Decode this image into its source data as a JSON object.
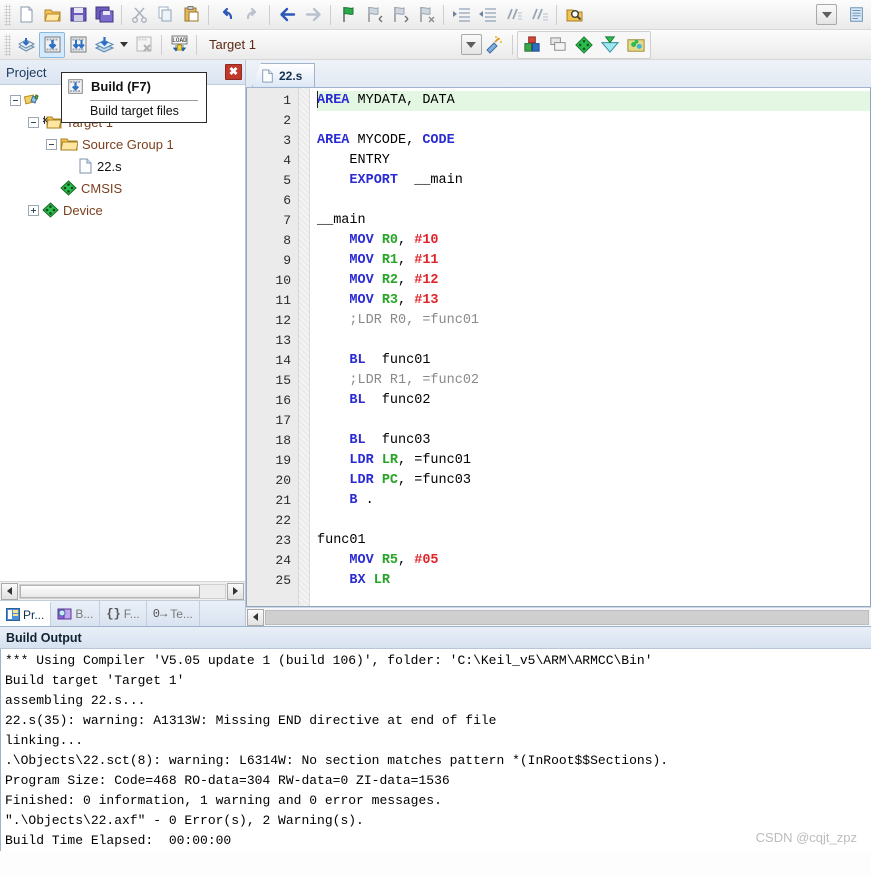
{
  "toolbar_main": {
    "buttons": [
      {
        "name": "new-file-icon",
        "title": "New"
      },
      {
        "name": "open-file-icon",
        "title": "Open"
      },
      {
        "name": "save-icon",
        "title": "Save"
      },
      {
        "name": "save-all-icon",
        "title": "Save All"
      },
      {
        "name": "cut-icon",
        "title": "Cut"
      },
      {
        "name": "copy-icon",
        "title": "Copy"
      },
      {
        "name": "paste-icon",
        "title": "Paste"
      },
      {
        "name": "undo-icon",
        "title": "Undo"
      },
      {
        "name": "redo-icon",
        "title": "Redo"
      },
      {
        "name": "navigate-back-icon",
        "title": "Back"
      },
      {
        "name": "navigate-forward-icon",
        "title": "Forward"
      },
      {
        "name": "bookmark-toggle-icon",
        "title": "Insert/Remove Bookmark"
      },
      {
        "name": "bookmark-prev-icon",
        "title": "Previous Bookmark"
      },
      {
        "name": "bookmark-next-icon",
        "title": "Next Bookmark"
      },
      {
        "name": "bookmark-clear-icon",
        "title": "Clear All Bookmarks"
      },
      {
        "name": "indent-icon",
        "title": "Indent"
      },
      {
        "name": "outdent-icon",
        "title": "Outdent"
      },
      {
        "name": "comment-icon",
        "title": "Comment"
      },
      {
        "name": "uncomment-icon",
        "title": "Uncomment"
      },
      {
        "name": "find-in-files-icon",
        "title": "Find in Files"
      }
    ]
  },
  "toolbar_build": {
    "buttons": [
      {
        "name": "translate-icon",
        "title": "Translate"
      },
      {
        "name": "build-icon",
        "title": "Build",
        "hot": true
      },
      {
        "name": "rebuild-icon",
        "title": "Rebuild"
      },
      {
        "name": "batch-build-icon",
        "title": "Batch Build"
      },
      {
        "name": "stop-build-icon",
        "title": "Stop Build"
      },
      {
        "name": "download-icon",
        "title": "Download"
      }
    ],
    "target": "Target 1",
    "target_options": [
      "Target 1"
    ],
    "right_buttons": [
      {
        "name": "target-options-icon",
        "title": "Options for Target"
      },
      {
        "name": "manage-project-items-icon",
        "title": "Manage Project Items"
      },
      {
        "name": "multi-project-icon",
        "title": "Multi-Project"
      },
      {
        "name": "pack-installer-icon",
        "title": "Pack Installer"
      },
      {
        "name": "manage-run-env-icon",
        "title": "Manage Run-Time Environment"
      },
      {
        "name": "pack-manage-icon",
        "title": "Select Software Packs"
      }
    ]
  },
  "tooltip": {
    "title": "Build (F7)",
    "description": "Build target files",
    "icon": "build-icon"
  },
  "project_panel": {
    "title": "Project",
    "close_label": "✖",
    "tree": [
      {
        "level": 0,
        "label": "",
        "icon": "project-icon",
        "expander": "minus",
        "hidden_label": true
      },
      {
        "level": 1,
        "label": "Target 1",
        "icon": "target-icon",
        "expander": "minus"
      },
      {
        "level": 2,
        "label": "Source Group 1",
        "icon": "folder-icon",
        "expander": "minus"
      },
      {
        "level": 3,
        "label": "22.s",
        "icon": "source-file-icon",
        "expander": "none"
      },
      {
        "level": 2,
        "label": "CMSIS",
        "icon": "component-icon",
        "expander": "none"
      },
      {
        "level": 2,
        "label": "Device",
        "icon": "component-icon",
        "expander": "plus"
      }
    ],
    "tabs": [
      {
        "label": "Pr...",
        "name": "tab-project",
        "icon": "project-tab-icon",
        "active": true
      },
      {
        "label": "B...",
        "name": "tab-books",
        "icon": "books-tab-icon",
        "active": false
      },
      {
        "label": "F...",
        "name": "tab-functions",
        "icon": "functions-tab-icon",
        "active": false
      },
      {
        "label": "Te...",
        "name": "tab-templates",
        "icon": "templates-tab-icon",
        "active": false
      }
    ]
  },
  "editor": {
    "tabs": [
      {
        "label": "22.s",
        "active": true,
        "icon": "source-file-icon"
      }
    ],
    "lines": [
      {
        "n": 1,
        "current": true,
        "tokens": [
          {
            "t": "AREA",
            "c": "kw"
          },
          {
            "t": " MYDATA, DATA",
            "c": ""
          }
        ]
      },
      {
        "n": 2,
        "current": false,
        "tokens": [
          {
            "t": "",
            "c": ""
          }
        ]
      },
      {
        "n": 3,
        "current": false,
        "tokens": [
          {
            "t": "AREA",
            "c": "kw"
          },
          {
            "t": " MYCODE, ",
            "c": ""
          },
          {
            "t": "CODE",
            "c": "kw"
          }
        ]
      },
      {
        "n": 4,
        "current": false,
        "tokens": [
          {
            "t": "    ",
            "c": ""
          },
          {
            "t": "ENTRY",
            "c": ""
          }
        ]
      },
      {
        "n": 5,
        "current": false,
        "tokens": [
          {
            "t": "    ",
            "c": ""
          },
          {
            "t": "EXPORT",
            "c": "kw"
          },
          {
            "t": "  __main",
            "c": ""
          }
        ]
      },
      {
        "n": 6,
        "current": false,
        "tokens": [
          {
            "t": "",
            "c": ""
          }
        ]
      },
      {
        "n": 7,
        "current": false,
        "tokens": [
          {
            "t": "__main",
            "c": ""
          }
        ]
      },
      {
        "n": 8,
        "current": false,
        "tokens": [
          {
            "t": "    ",
            "c": ""
          },
          {
            "t": "MOV",
            "c": "kw"
          },
          {
            "t": " ",
            "c": ""
          },
          {
            "t": "R0",
            "c": "reg"
          },
          {
            "t": ", ",
            "c": ""
          },
          {
            "t": "#10",
            "c": "num"
          }
        ]
      },
      {
        "n": 9,
        "current": false,
        "tokens": [
          {
            "t": "    ",
            "c": ""
          },
          {
            "t": "MOV",
            "c": "kw"
          },
          {
            "t": " ",
            "c": ""
          },
          {
            "t": "R1",
            "c": "reg"
          },
          {
            "t": ", ",
            "c": ""
          },
          {
            "t": "#11",
            "c": "num"
          }
        ]
      },
      {
        "n": 10,
        "current": false,
        "tokens": [
          {
            "t": "    ",
            "c": ""
          },
          {
            "t": "MOV",
            "c": "kw"
          },
          {
            "t": " ",
            "c": ""
          },
          {
            "t": "R2",
            "c": "reg"
          },
          {
            "t": ", ",
            "c": ""
          },
          {
            "t": "#12",
            "c": "num"
          }
        ]
      },
      {
        "n": 11,
        "current": false,
        "tokens": [
          {
            "t": "    ",
            "c": ""
          },
          {
            "t": "MOV",
            "c": "kw"
          },
          {
            "t": " ",
            "c": ""
          },
          {
            "t": "R3",
            "c": "reg"
          },
          {
            "t": ", ",
            "c": ""
          },
          {
            "t": "#13",
            "c": "num"
          }
        ]
      },
      {
        "n": 12,
        "current": false,
        "tokens": [
          {
            "t": "    ",
            "c": ""
          },
          {
            "t": ";LDR R0, =func01",
            "c": "cmt"
          }
        ]
      },
      {
        "n": 13,
        "current": false,
        "tokens": [
          {
            "t": "",
            "c": ""
          }
        ]
      },
      {
        "n": 14,
        "current": false,
        "tokens": [
          {
            "t": "    ",
            "c": ""
          },
          {
            "t": "BL",
            "c": "kw"
          },
          {
            "t": "  func01",
            "c": ""
          }
        ]
      },
      {
        "n": 15,
        "current": false,
        "tokens": [
          {
            "t": "    ",
            "c": ""
          },
          {
            "t": ";LDR R1, =func02",
            "c": "cmt"
          }
        ]
      },
      {
        "n": 16,
        "current": false,
        "tokens": [
          {
            "t": "    ",
            "c": ""
          },
          {
            "t": "BL",
            "c": "kw"
          },
          {
            "t": "  func02",
            "c": ""
          }
        ]
      },
      {
        "n": 17,
        "current": false,
        "tokens": [
          {
            "t": "",
            "c": ""
          }
        ]
      },
      {
        "n": 18,
        "current": false,
        "tokens": [
          {
            "t": "    ",
            "c": ""
          },
          {
            "t": "BL",
            "c": "kw"
          },
          {
            "t": "  func03",
            "c": ""
          }
        ]
      },
      {
        "n": 19,
        "current": false,
        "tokens": [
          {
            "t": "    ",
            "c": ""
          },
          {
            "t": "LDR",
            "c": "kw"
          },
          {
            "t": " ",
            "c": ""
          },
          {
            "t": "LR",
            "c": "reg"
          },
          {
            "t": ", =func01",
            "c": ""
          }
        ]
      },
      {
        "n": 20,
        "current": false,
        "tokens": [
          {
            "t": "    ",
            "c": ""
          },
          {
            "t": "LDR",
            "c": "kw"
          },
          {
            "t": " ",
            "c": ""
          },
          {
            "t": "PC",
            "c": "reg"
          },
          {
            "t": ", =func03",
            "c": ""
          }
        ]
      },
      {
        "n": 21,
        "current": false,
        "tokens": [
          {
            "t": "    ",
            "c": ""
          },
          {
            "t": "B",
            "c": "kw"
          },
          {
            "t": " .",
            "c": ""
          }
        ]
      },
      {
        "n": 22,
        "current": false,
        "tokens": [
          {
            "t": "",
            "c": ""
          }
        ]
      },
      {
        "n": 23,
        "current": false,
        "tokens": [
          {
            "t": "func01",
            "c": ""
          }
        ]
      },
      {
        "n": 24,
        "current": false,
        "tokens": [
          {
            "t": "    ",
            "c": ""
          },
          {
            "t": "MOV",
            "c": "kw"
          },
          {
            "t": " ",
            "c": ""
          },
          {
            "t": "R5",
            "c": "reg"
          },
          {
            "t": ", ",
            "c": ""
          },
          {
            "t": "#05",
            "c": "num"
          }
        ]
      },
      {
        "n": 25,
        "current": false,
        "tokens": [
          {
            "t": "    ",
            "c": ""
          },
          {
            "t": "BX",
            "c": "kw"
          },
          {
            "t": " ",
            "c": ""
          },
          {
            "t": "LR",
            "c": "reg"
          }
        ]
      }
    ]
  },
  "build_output": {
    "title": "Build Output",
    "lines": [
      "*** Using Compiler 'V5.05 update 1 (build 106)', folder: 'C:\\Keil_v5\\ARM\\ARMCC\\Bin'",
      "Build target 'Target 1'",
      "assembling 22.s...",
      "22.s(35): warning: A1313W: Missing END directive at end of file",
      "linking...",
      ".\\Objects\\22.sct(8): warning: L6314W: No section matches pattern *(InRoot$$Sections).",
      "Program Size: Code=468 RO-data=304 RW-data=0 ZI-data=1536",
      "Finished: 0 information, 1 warning and 0 error messages.",
      "\".\\Objects\\22.axf\" - 0 Error(s), 2 Warning(s).",
      "Build Time Elapsed:  00:00:00"
    ],
    "watermark": "CSDN @cqjt_zpz"
  },
  "colors": {
    "keyword": "#2b2bd4",
    "register": "#27a527",
    "immediate": "#e0242a",
    "comment": "#8a8a8a",
    "current_line": "#e3f7e3",
    "target_text": "#5a2a14",
    "tree_text": "#7b3f1d"
  }
}
